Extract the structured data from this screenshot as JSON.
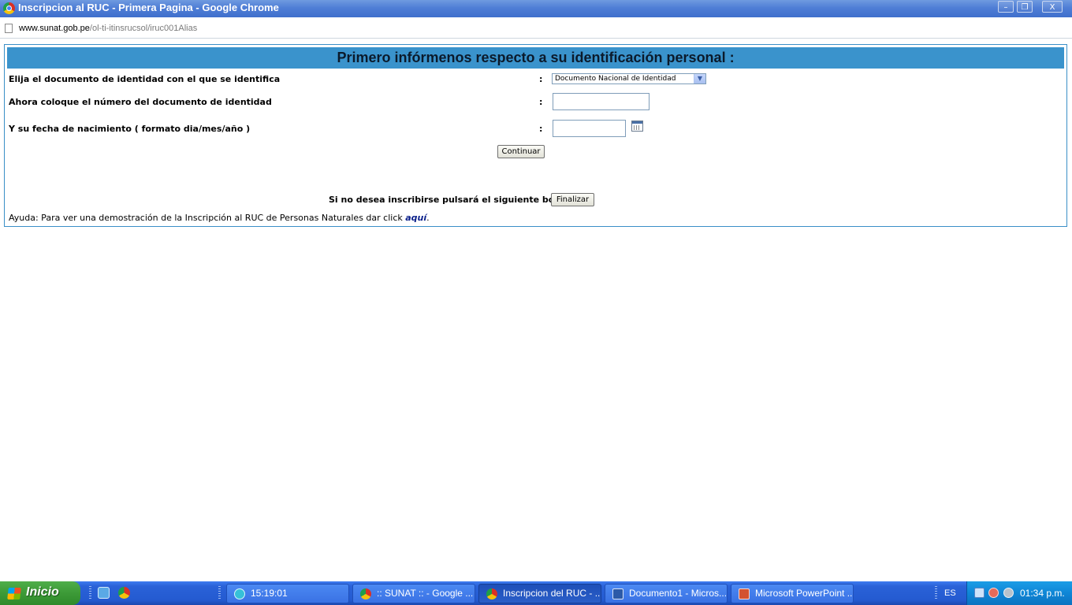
{
  "window": {
    "title": "Inscripcion al RUC - Primera Pagina - Google Chrome",
    "buttons": {
      "minimize": "–",
      "maximize": "❐",
      "close": "X"
    }
  },
  "address_bar": {
    "url_host": "www.sunat.gob.pe",
    "url_path": "/ol-ti-itinsrucsol/iruc001Alias"
  },
  "form": {
    "header": "Primero infórmenos respecto a su identificación personal :",
    "colon": ":",
    "document_type": {
      "label": "Elija el documento de identidad con el que se identifica",
      "selected": "Documento Nacional de Identidad"
    },
    "document_number": {
      "label": "Ahora coloque el número del documento de identidad",
      "value": ""
    },
    "birth_date": {
      "label": "Y su fecha de nacimiento ( formato dia/mes/año )",
      "value": ""
    },
    "continue_button": "Continuar",
    "cancel_prompt": "Si no desea inscribirse pulsará el siguiente botón",
    "finish_button": "Finalizar",
    "help": {
      "prefix": "Ayuda: Para ver una demostración de la Inscripción al RUC de Personas Naturales dar click",
      "link": "aquí",
      "suffix": "."
    }
  },
  "taskbar": {
    "start_label": "Inicio",
    "tasks": [
      {
        "label": "15:19:01",
        "icon": "clock-app-icon"
      },
      {
        "label": ":: SUNAT :: - Google ...",
        "icon": "chrome-icon"
      },
      {
        "label": "Inscripcion del RUC - ...",
        "icon": "chrome-icon",
        "active": true
      },
      {
        "label": "Documento1 - Micros...",
        "icon": "word-icon"
      },
      {
        "label": "Microsoft PowerPoint ...",
        "icon": "powerpoint-icon"
      }
    ],
    "language": "ES",
    "clock": "01:34 p.m."
  }
}
